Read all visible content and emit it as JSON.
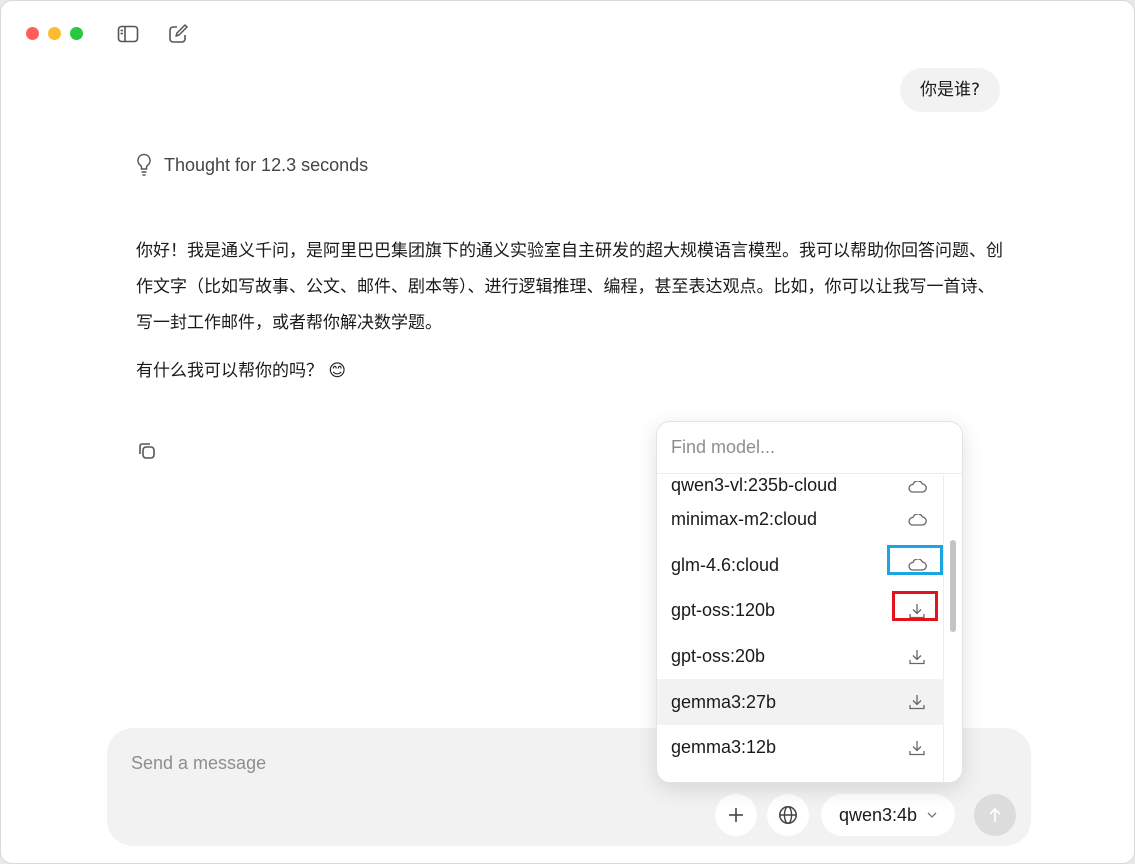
{
  "window": {
    "colors": {
      "close": "#ff5f57",
      "minimize": "#febc2e",
      "zoom": "#28c840"
    },
    "toolbar": {
      "sidebar_icon": "sidebar-toggle-icon",
      "compose_icon": "compose-icon"
    }
  },
  "chat": {
    "user_message": "你是谁?",
    "thought_label": "Thought for 12.3 seconds",
    "assistant_paragraph_1": "你好！我是通义千问，是阿里巴巴集团旗下的通义实验室自主研发的超大规模语言模型。我可以帮助你回答问题、创作文字（比如写故事、公文、邮件、剧本等）、进行逻辑推理、编程，甚至表达观点。比如，你可以让我写一首诗、写一封工作邮件，或者帮你解决数学题。",
    "assistant_paragraph_2": "有什么我可以帮你的吗？",
    "emoji": "😊"
  },
  "composer": {
    "placeholder": "Send a message",
    "selected_model": "qwen3:4b"
  },
  "model_picker": {
    "search_placeholder": "Find model...",
    "models": [
      {
        "name": "qwen3-vl:235b-cloud",
        "icon": "cloud-icon"
      },
      {
        "name": "minimax-m2:cloud",
        "icon": "cloud-icon"
      },
      {
        "name": "glm-4.6:cloud",
        "icon": "cloud-icon",
        "highlight": "#1aa6e6"
      },
      {
        "name": "gpt-oss:120b",
        "icon": "download-icon",
        "highlight": "#e3131b"
      },
      {
        "name": "gpt-oss:20b",
        "icon": "download-icon"
      },
      {
        "name": "gemma3:27b",
        "icon": "download-icon",
        "hovered": true
      },
      {
        "name": "gemma3:12b",
        "icon": "download-icon"
      }
    ]
  }
}
